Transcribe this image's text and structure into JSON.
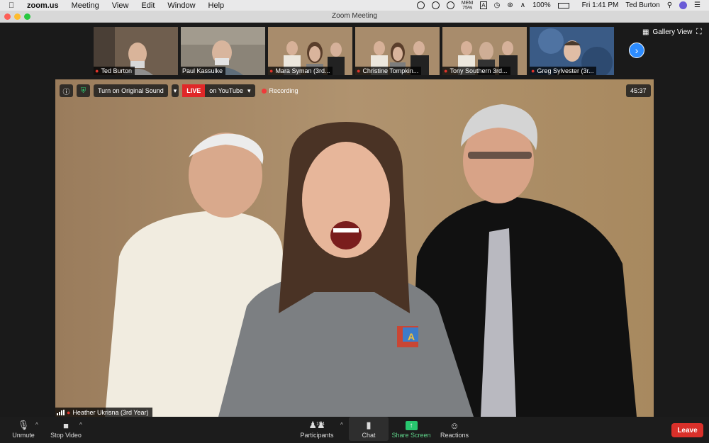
{
  "menubar": {
    "app_name": "zoom.us",
    "menus": [
      "Meeting",
      "View",
      "Edit",
      "Window",
      "Help"
    ],
    "mem_label": "MEM",
    "mem_value": "75%",
    "battery": "100%",
    "clock": "Fri 1:41 PM",
    "user": "Ted Burton"
  },
  "window": {
    "title": "Zoom Meeting"
  },
  "strip": {
    "participants": [
      {
        "name": "Ted Burton"
      },
      {
        "name": "Paul Kassulke"
      },
      {
        "name": "Mara Syman (3rd..."
      },
      {
        "name": "Christine Tompkin..."
      },
      {
        "name": "Tony Southern 3rd..."
      },
      {
        "name": "Greg Sylvester (3r..."
      }
    ],
    "gallery_label": "Gallery View"
  },
  "main": {
    "original_sound": "Turn on Original Sound",
    "live_label": "LIVE",
    "live_platform": "on YouTube",
    "recording": "Recording",
    "timer": "45:37",
    "speaker_name": "Heather Ukrisna (3rd Year)"
  },
  "controls": {
    "unmute": "Unmute",
    "stop_video": "Stop Video",
    "participants": "Participants",
    "participant_count": "154",
    "chat": "Chat",
    "share_screen": "Share Screen",
    "reactions": "Reactions",
    "leave": "Leave"
  },
  "colors": {
    "accent_blue": "#2d8cff",
    "live_red": "#e02828",
    "share_green": "#28c76f",
    "leave_red": "#d9302a"
  }
}
